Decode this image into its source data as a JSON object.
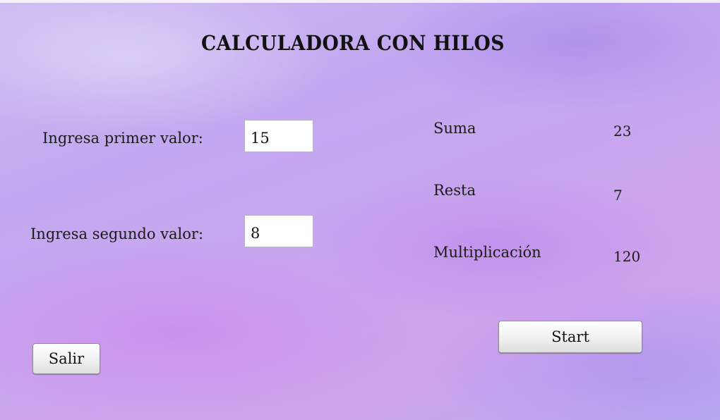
{
  "window": {
    "title": "CALCULADORA CON HILOS"
  },
  "inputs": {
    "first": {
      "label": "Ingresa primer valor:",
      "value": "15"
    },
    "second": {
      "label": "Ingresa segundo valor:",
      "value": "8"
    }
  },
  "results": {
    "suma": {
      "label": "Suma",
      "value": "23"
    },
    "resta": {
      "label": "Resta",
      "value": "7"
    },
    "multiplicacion": {
      "label": "Multiplicación",
      "value": "120"
    }
  },
  "buttons": {
    "start_label": "Start",
    "exit_label": "Salir"
  },
  "colors": {
    "background": "#c7aaf0",
    "text": "#1a1a1a"
  }
}
